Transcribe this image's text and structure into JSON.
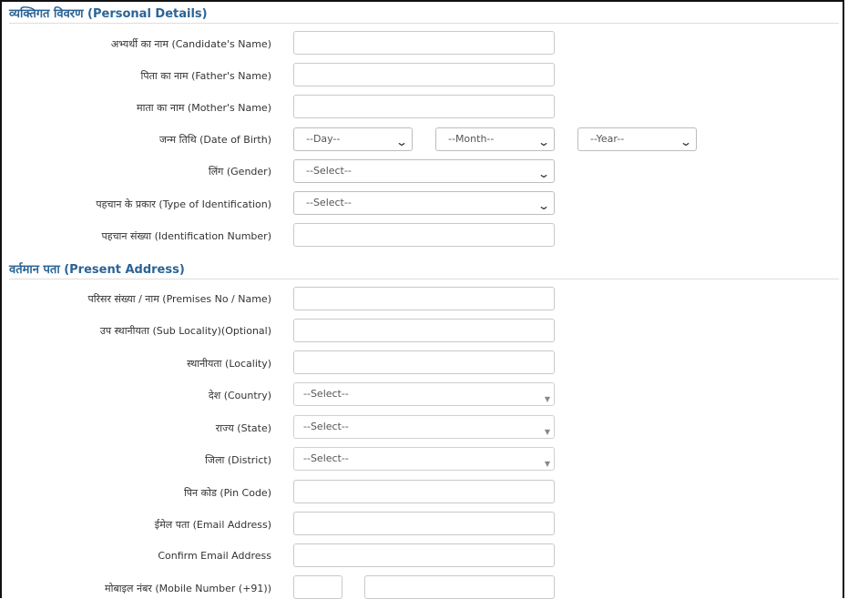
{
  "personal": {
    "title": "व्यक्तिगत विवरण (Personal Details)",
    "candidate_name_label": "अभ्यर्थी का नाम (Candidate's Name)",
    "father_name_label": "पिता का नाम (Father's Name)",
    "mother_name_label": "माता का नाम (Mother's Name)",
    "dob_label": "जन्म तिथि (Date of Birth)",
    "dob_day": "--Day--",
    "dob_month": "--Month--",
    "dob_year": "--Year--",
    "gender_label": "लिंग (Gender)",
    "gender_value": "--Select--",
    "id_type_label": "पहचान के प्रकार (Type of Identification)",
    "id_type_value": "--Select--",
    "id_number_label": "पहचान संख्या (Identification Number)"
  },
  "address": {
    "title": "वर्तमान पता (Present Address)",
    "premises_label": "परिसर संख्या / नाम (Premises No / Name)",
    "sub_locality_label": "उप स्थानीयता (Sub Locality)(Optional)",
    "locality_label": "स्थानीयता (Locality)",
    "country_label": "देश (Country)",
    "country_value": "--Select--",
    "state_label": "राज्य (State)",
    "state_value": "--Select--",
    "district_label": "जिला (District)",
    "district_value": "--Select--",
    "pin_label": "पिन कोड (Pin Code)",
    "email_label": "ईमेल पता (Email Address)",
    "confirm_email_label": "Confirm Email Address",
    "mobile_label": "मोबाइल नंबर (Mobile Number (+91))"
  },
  "icons": {
    "chevron": "chevron-down-icon",
    "dropdown_triangle": "dropdown-triangle-icon"
  }
}
